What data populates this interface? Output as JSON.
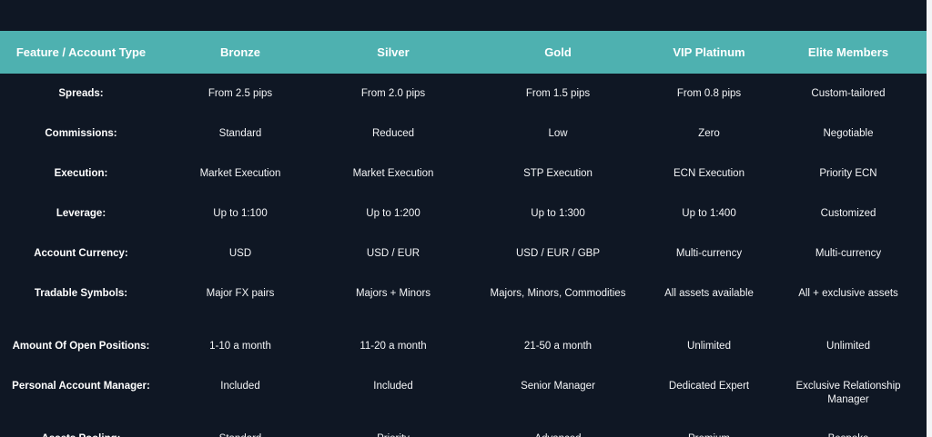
{
  "table": {
    "headers": [
      "Feature / Account Type",
      "Bronze",
      "Silver",
      "Gold",
      "VIP Platinum",
      "Elite Members"
    ],
    "rows": [
      {
        "label": "Spreads:",
        "values": [
          "From 2.5 pips",
          "From 2.0 pips",
          "From 1.5 pips",
          "From 0.8 pips",
          "Custom-tailored"
        ]
      },
      {
        "label": "Commissions:",
        "values": [
          "Standard",
          "Reduced",
          "Low",
          "Zero",
          "Negotiable"
        ]
      },
      {
        "label": "Execution:",
        "values": [
          "Market Execution",
          "Market Execution",
          "STP Execution",
          "ECN Execution",
          "Priority ECN"
        ]
      },
      {
        "label": "Leverage:",
        "values": [
          "Up to 1:100",
          "Up to 1:200",
          "Up to 1:300",
          "Up to 1:400",
          "Customized"
        ]
      },
      {
        "label": "Account Currency:",
        "values": [
          "USD",
          "USD / EUR",
          "USD / EUR / GBP",
          "Multi-currency",
          "Multi-currency"
        ]
      },
      {
        "label": "Tradable Symbols:",
        "values": [
          "Major FX pairs",
          "Majors + Minors",
          "Majors, Minors, Commodities",
          "All assets available",
          "All + exclusive assets"
        ]
      },
      {
        "label": "Amount Of Open Positions:",
        "values": [
          "1-10 a month",
          "11-20 a month",
          "21-50 a month",
          "Unlimited",
          "Unlimited"
        ]
      },
      {
        "label": "Personal Account Manager:",
        "values": [
          "Included",
          "Included",
          "Senior Manager",
          "Dedicated Expert",
          "Exclusive Relationship Manager"
        ]
      },
      {
        "label": "Assets Pooling:",
        "values": [
          "Standard",
          "Priority",
          "Advanced",
          "Premium",
          "Bespoke"
        ]
      }
    ]
  },
  "colors": {
    "background": "#0f1724",
    "header_bg": "#4eb1b0",
    "text": "#f3f4f6"
  }
}
